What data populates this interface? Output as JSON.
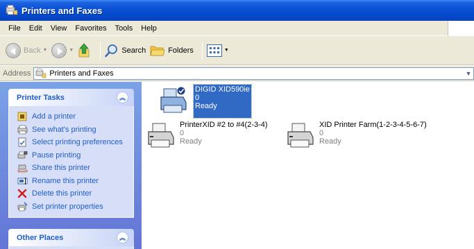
{
  "window": {
    "title": "Printers and Faxes"
  },
  "menu": [
    "File",
    "Edit",
    "View",
    "Favorites",
    "Tools",
    "Help"
  ],
  "toolbar": {
    "back_label": "Back",
    "search_label": "Search",
    "folders_label": "Folders"
  },
  "address": {
    "label": "Address",
    "value": "Printers and Faxes"
  },
  "printer_tasks": {
    "title": "Printer Tasks",
    "items": [
      {
        "label": "Add a printer",
        "icon": "add-printer-icon"
      },
      {
        "label": "See what's printing",
        "icon": "print-queue-icon"
      },
      {
        "label": "Select printing preferences",
        "icon": "preferences-icon"
      },
      {
        "label": "Pause printing",
        "icon": "pause-printer-icon"
      },
      {
        "label": "Share this printer",
        "icon": "share-printer-icon"
      },
      {
        "label": "Rename this printer",
        "icon": "rename-icon"
      },
      {
        "label": "Delete this printer",
        "icon": "delete-x-icon"
      },
      {
        "label": "Set printer properties",
        "icon": "properties-icon"
      }
    ]
  },
  "other_places": {
    "title": "Other Places"
  },
  "printers": [
    {
      "name": "DIGID XID590ie",
      "documents": "0",
      "status": "Ready",
      "default": true,
      "selected": true
    },
    {
      "name": "PrinterXID #2 to #4(2-3-4)",
      "documents": "0",
      "status": "Ready",
      "default": false,
      "selected": false
    },
    {
      "name": "XID Printer Farm(1-2-3-4-5-6-7)",
      "documents": "0",
      "status": "Ready",
      "default": false,
      "selected": false
    }
  ],
  "colors": {
    "title_bar": "#0a52d6",
    "task_pane": "#7ba2e7",
    "task_link": "#215dc6",
    "selection": "#316ac5"
  }
}
